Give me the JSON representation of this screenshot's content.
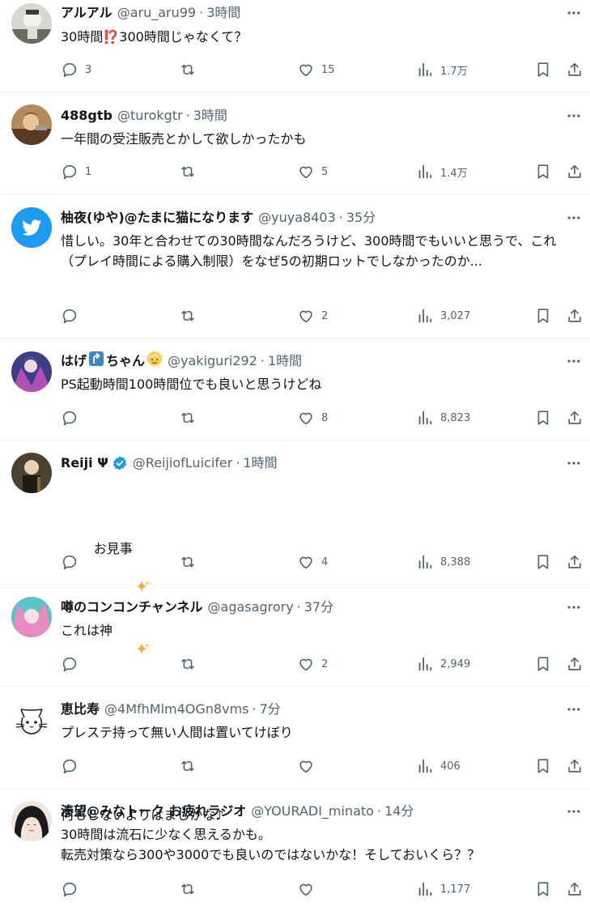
{
  "tweets": [
    {
      "name": "アルアル",
      "handle": "@aru_aru99",
      "time": "3時間",
      "text": "30時間⁉️300時間じゃなくて？",
      "counts": {
        "reply": "3",
        "retweet": "",
        "like": "15",
        "views": "1.7万"
      }
    },
    {
      "name": "488gtb",
      "handle": "@turokgtr",
      "time": "3時間",
      "text": "一年間の受注販売とかして欲しかったかも",
      "counts": {
        "reply": "1",
        "retweet": "",
        "like": "5",
        "views": "1.4万"
      }
    },
    {
      "name": "柚夜(ゆや)@たまに猫になります",
      "handle": "@yuya8403",
      "time": "35分",
      "text": "惜しい。30年と合わせての30時間なんだろうけど、300時間でもいいと思うで、これ（プレイ時間による購入制限）をなぜ5の初期ロットでしなかったのか...",
      "counts": {
        "reply": "",
        "retweet": "",
        "like": "2",
        "views": "3,027"
      }
    },
    {
      "name_a": "はげ",
      "name_b": "ちゃん",
      "handle": "@yakiguri292",
      "time": "1時間",
      "text": "PS起動時間100時間位でも良いと思うけどね",
      "counts": {
        "reply": "",
        "retweet": "",
        "like": "8",
        "views": "8,823"
      }
    },
    {
      "name": "Reiji Ψ",
      "handle": "@ReijiofLuicifer",
      "time": "1時間",
      "text_a": "お見事",
      "text_b": "何もしないよりはましかな♪",
      "counts": {
        "reply": "",
        "retweet": "",
        "like": "4",
        "views": "8,388"
      }
    },
    {
      "name": "噂のコンコンチャンネル",
      "handle": "@agasagrory",
      "time": "37分",
      "text": "これは神",
      "counts": {
        "reply": "",
        "retweet": "",
        "like": "2",
        "views": "2,949"
      }
    },
    {
      "name": "恵比寿",
      "handle": "@4MfhMlm4OGn8vms",
      "time": "7分",
      "text": "プレステ持って無い人間は置いてけぼり",
      "counts": {
        "reply": "",
        "retweet": "",
        "like": "",
        "views": "406"
      }
    },
    {
      "name": "湊望@みなトーク お疲れラジオ",
      "handle": "@YOURADI_minato",
      "time": "14分",
      "text": "30時間は流石に少なく思えるかも。\n転売対策なら300や3000でも良いのではないかな！そしておいくら？？",
      "counts": {
        "reply": "",
        "retweet": "",
        "like": "",
        "views": "1,177"
      }
    }
  ],
  "colors": {
    "text": "#0f1419",
    "secondary": "#536471",
    "divider": "#eff3f4",
    "verified": "#1d9bf0",
    "twitter_blue": "#1d9bf0"
  },
  "icons": {
    "reply": "reply-icon",
    "retweet": "retweet-icon",
    "like": "heart-icon",
    "views": "views-icon",
    "bookmark": "bookmark-icon",
    "share": "share-icon",
    "more": "more-icon"
  }
}
